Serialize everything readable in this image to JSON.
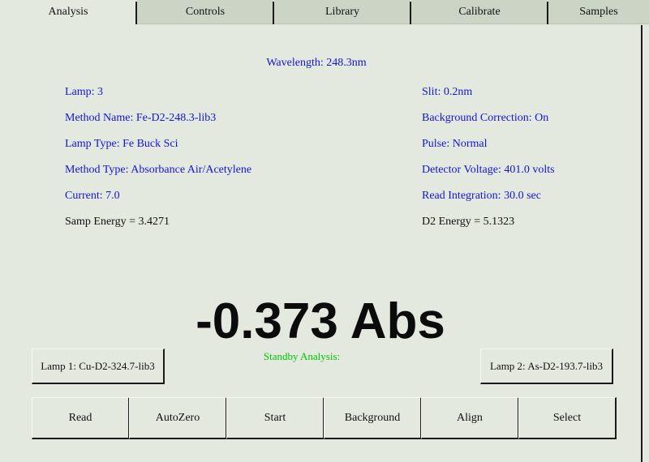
{
  "window": {
    "background_color": "#e4e9e0",
    "accent_text_color": "#1414d2",
    "status_color": "#00c400"
  },
  "tabs": [
    {
      "label": "Analysis",
      "active": true
    },
    {
      "label": "Controls",
      "active": false
    },
    {
      "label": "Library",
      "active": false
    },
    {
      "label": "Calibrate",
      "active": false
    },
    {
      "label": "Samples",
      "active": false
    }
  ],
  "header": {
    "wavelength": "Wavelength: 248.3nm"
  },
  "parameters": {
    "left": [
      "Lamp: 3",
      "Method Name: Fe-D2-248.3-lib3",
      "Lamp Type: Fe Buck Sci",
      "Method Type: Absorbance Air/Acetylene",
      "Current: 7.0",
      "Samp Energy = 3.4271"
    ],
    "right": [
      "Slit: 0.2nm",
      "Background Correction: On",
      "Pulse: Normal",
      "Detector Voltage: 401.0 volts",
      "Read Integration: 30.0 sec",
      "D2 Energy = 5.1323"
    ]
  },
  "readout": {
    "value": "-0.373 Abs",
    "status": "Standby Analysis:"
  },
  "lamps": {
    "lamp1": "Lamp 1: Cu-D2-324.7-lib3",
    "lamp2": "Lamp 2: As-D2-193.7-lib3"
  },
  "buttons": [
    "Read",
    "AutoZero",
    "Start",
    "Background",
    "Align",
    "Select"
  ]
}
